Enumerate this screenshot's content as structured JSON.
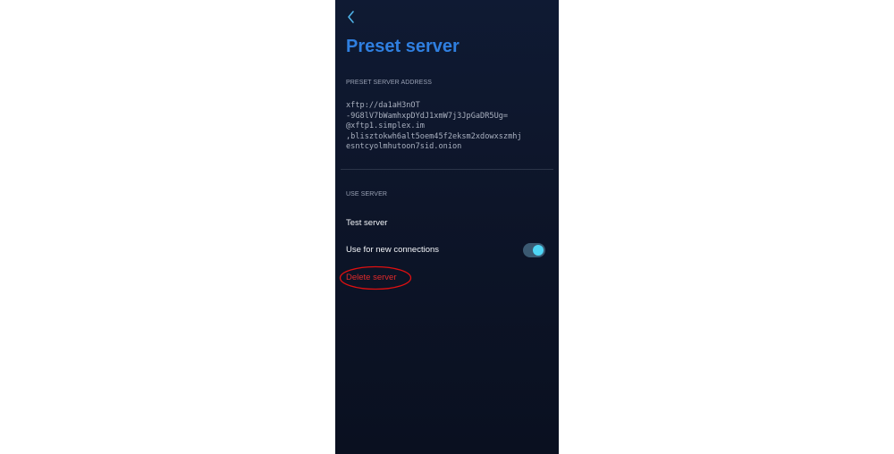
{
  "header": {
    "back_icon": "chevron-left-icon",
    "title": "Preset server"
  },
  "address_section": {
    "label": "PRESET SERVER ADDRESS",
    "lines": [
      "xftp://da1aH3nOT",
      "-9G8lV7bWamhxpDYdJ1xmW7j3JpGaDR5Ug=",
      "@xftp1.simplex.im",
      ",blisztokwh6alt5oem45f2eksm2xdowxszmhj",
      "esntcyolmhutoon7sid.onion"
    ]
  },
  "use_server_section": {
    "label": "USE SERVER",
    "test_label": "Test server",
    "use_new_label": "Use for new connections",
    "use_new_enabled": true,
    "delete_label": "Delete server"
  },
  "colors": {
    "title": "#2f7fe0",
    "toggle_on": "#4fd6f5",
    "delete": "#e02a2a",
    "annotation_circle": "#e01010"
  }
}
